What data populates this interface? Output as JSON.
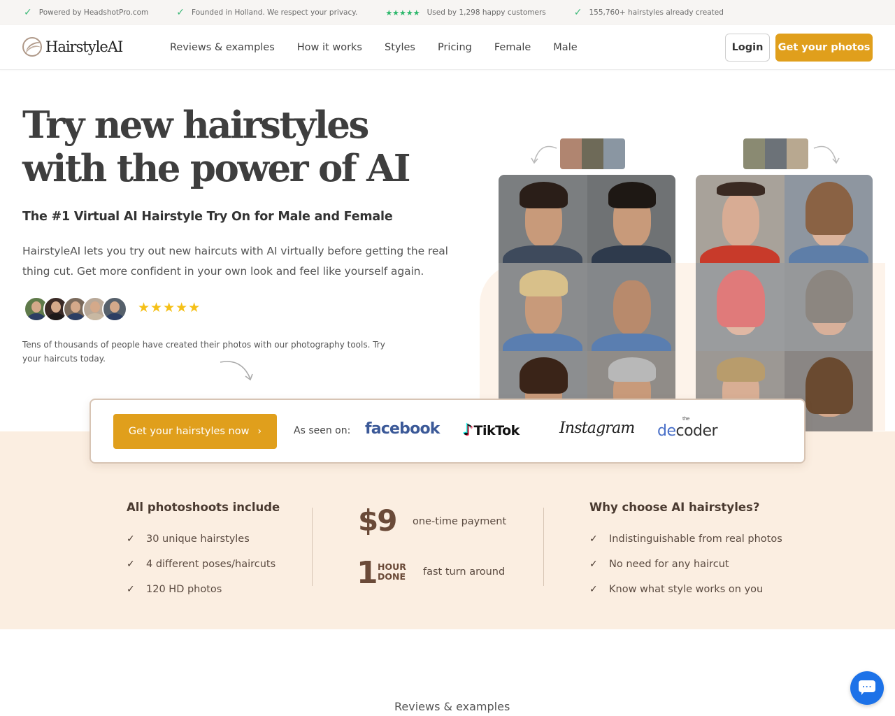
{
  "topbar": {
    "items": [
      {
        "icon": "check-icon",
        "text": "Powered by HeadshotPro.com"
      },
      {
        "icon": "check-icon",
        "text": "Founded in Holland. We respect your privacy."
      },
      {
        "icon": "stars-icon",
        "stars": "★★★★★",
        "text": "Used by 1,298 happy customers"
      },
      {
        "icon": "check-icon",
        "text": "155,760+ hairstyles already created"
      }
    ]
  },
  "nav": {
    "brand": "HairstyleAI",
    "links": [
      "Reviews & examples",
      "How it works",
      "Styles",
      "Pricing",
      "Female",
      "Male"
    ],
    "login_label": "Login",
    "cta_label": "Get your photos"
  },
  "hero": {
    "title_line1": "Try new hairstyles",
    "title_line2": "with the power of AI",
    "subtitle": "The #1 Virtual AI Hairstyle Try On for Male and Female",
    "description": "HairstyleAI lets you try out new haircuts with AI virtually before getting the real thing cut. Get more confident in your own look and feel like yourself again.",
    "rating_stars": "★★★★★",
    "social_proof": "Tens of thousands of people have created their photos with our photography tools. Try your haircuts today."
  },
  "seen_on": {
    "cta_label": "Get your hairstyles now",
    "cta_chevron": "›",
    "label": "As seen on:",
    "logos": {
      "facebook": "facebook",
      "tiktok": "TikTok",
      "tiktok_note": "♪",
      "instagram": "Instagram",
      "decoder_the": "the",
      "decoder_de": "de",
      "decoder_rest": "coder"
    }
  },
  "features": {
    "includes_title": "All photoshoots include",
    "includes": [
      "30 unique hairstyles",
      "4 different poses/haircuts",
      "120 HD photos"
    ],
    "price": "$9",
    "price_label": "one-time payment",
    "hour_number": "1",
    "hour_line1": "HOUR",
    "hour_line2": "DONE",
    "hour_label": "fast turn around",
    "why_title": "Why choose AI hairstyles?",
    "why": [
      "Indistinguishable from real photos",
      "No need for any haircut",
      "Know what style works on you"
    ]
  },
  "reviews": {
    "heading": "Reviews & examples"
  },
  "colors": {
    "accent": "#e09f1c",
    "band": "#fbeee1",
    "check_green": "#3cb878",
    "chat_blue": "#1d72e8"
  }
}
